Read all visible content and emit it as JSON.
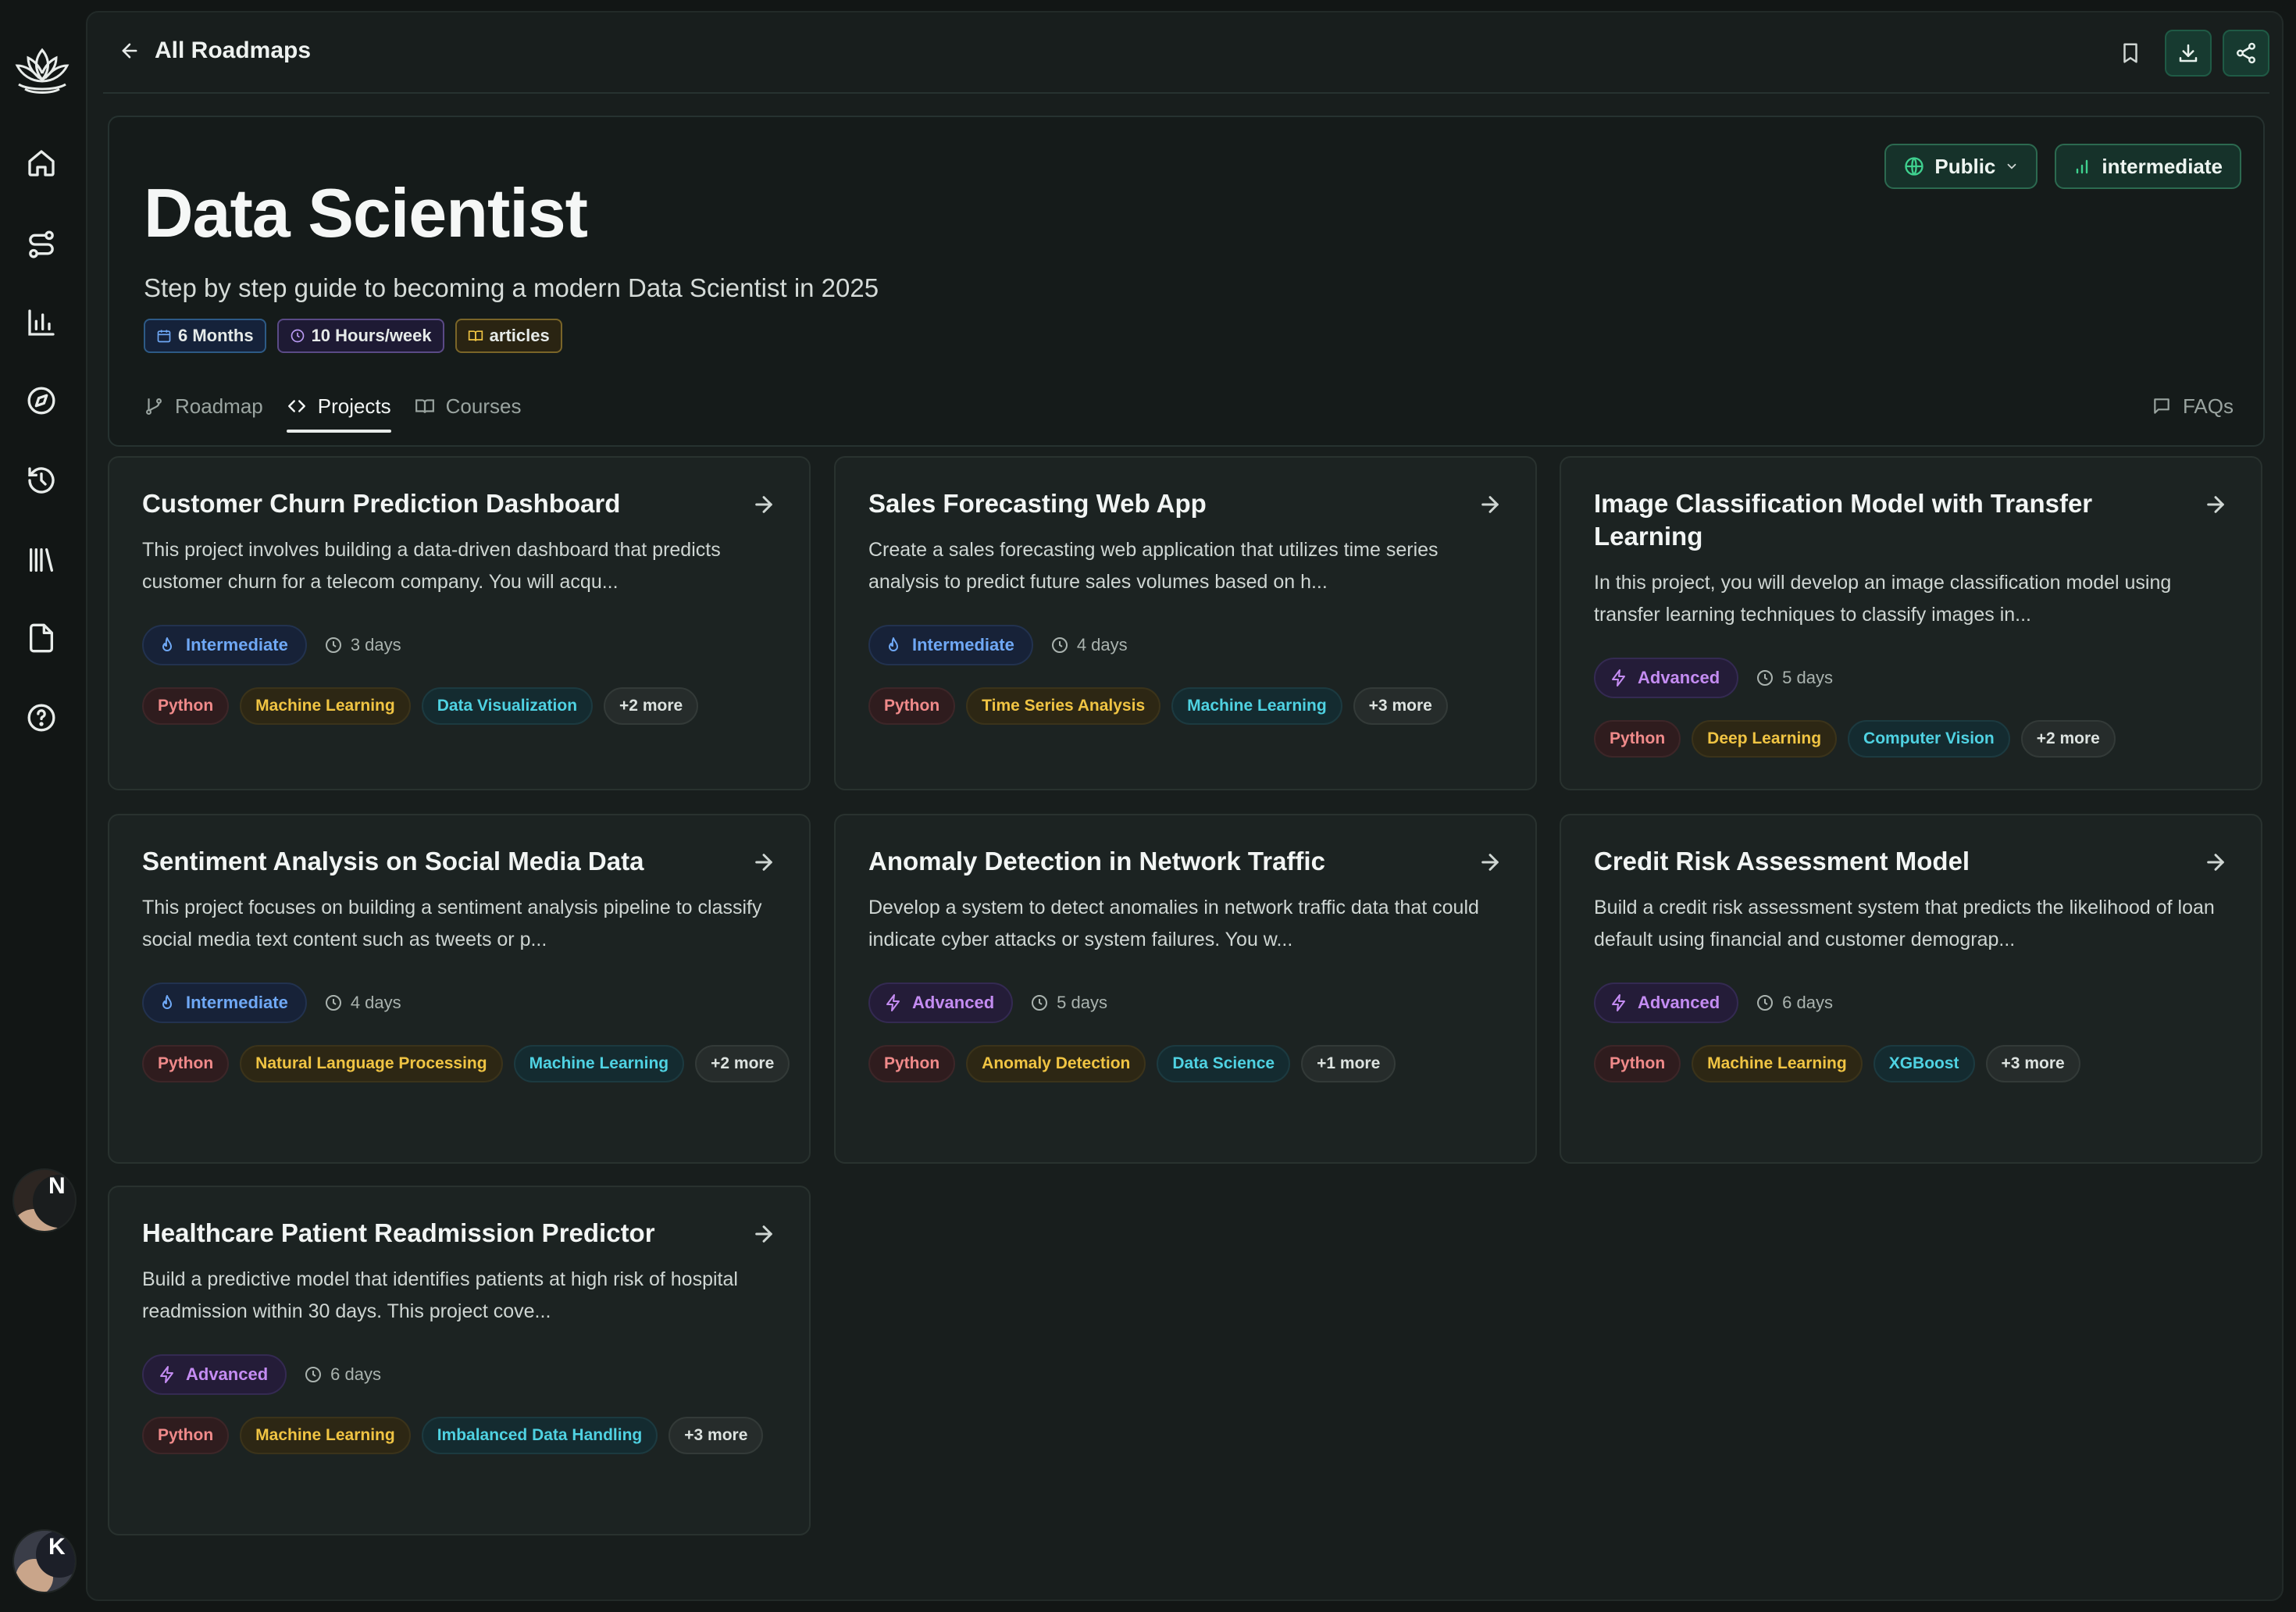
{
  "nav": {
    "back_label": "All Roadmaps"
  },
  "roadmap": {
    "title": "Data Scientist",
    "subtitle": "Step by step guide to becoming a modern Data Scientist in 2025",
    "badges": {
      "duration": "6 Months",
      "hours": "10 Hours/week",
      "format": "articles"
    },
    "visibility": "Public",
    "level": "intermediate"
  },
  "tabs": {
    "roadmap": "Roadmap",
    "projects": "Projects",
    "courses": "Courses",
    "faqs": "FAQs"
  },
  "avatar": {
    "initial_top": "N",
    "initial_bottom": "K"
  },
  "projects": [
    {
      "title": "Customer Churn Prediction Dashboard",
      "description": "This project involves building a data-driven dashboard that predicts customer churn for a telecom company. You will acqu...",
      "level": "Intermediate",
      "duration": "3 days",
      "tags": [
        "Python",
        "Machine Learning",
        "Data Visualization",
        "+2 more"
      ]
    },
    {
      "title": "Sales Forecasting Web App",
      "description": "Create a sales forecasting web application that utilizes time series analysis to predict future sales volumes based on h...",
      "level": "Intermediate",
      "duration": "4 days",
      "tags": [
        "Python",
        "Time Series Analysis",
        "Machine Learning",
        "+3 more"
      ]
    },
    {
      "title": "Image Classification Model with Transfer Learning",
      "description": "In this project, you will develop an image classification model using transfer learning techniques to classify images in...",
      "level": "Advanced",
      "duration": "5 days",
      "tags": [
        "Python",
        "Deep Learning",
        "Computer Vision",
        "+2 more"
      ]
    },
    {
      "title": "Sentiment Analysis on Social Media Data",
      "description": "This project focuses on building a sentiment analysis pipeline to classify social media text content such as tweets or p...",
      "level": "Intermediate",
      "duration": "4 days",
      "tags": [
        "Python",
        "Natural Language Processing",
        "Machine Learning",
        "+2 more"
      ]
    },
    {
      "title": "Anomaly Detection in Network Traffic",
      "description": "Develop a system to detect anomalies in network traffic data that could indicate cyber attacks or system failures. You w...",
      "level": "Advanced",
      "duration": "5 days",
      "tags": [
        "Python",
        "Anomaly Detection",
        "Data Science",
        "+1 more"
      ]
    },
    {
      "title": "Credit Risk Assessment Model",
      "description": "Build a credit risk assessment system that predicts the likelihood of loan default using financial and customer demograp...",
      "level": "Advanced",
      "duration": "6 days",
      "tags": [
        "Python",
        "Machine Learning",
        "XGBoost",
        "+3 more"
      ]
    },
    {
      "title": "Healthcare Patient Readmission Predictor",
      "description": "Build a predictive model that identifies patients at high risk of hospital readmission within 30 days. This project cove...",
      "level": "Advanced",
      "duration": "6 days",
      "tags": [
        "Python",
        "Machine Learning",
        "Imbalanced Data Handling",
        "+3 more"
      ]
    }
  ],
  "colors": {
    "background": "#121615",
    "panel": "#181e1d",
    "card": "#1c2322",
    "accent_green": "#2c6a50",
    "intermediate": "#6fa8f5",
    "advanced": "#c48cf2",
    "tag_python": "#f08a8a",
    "tag_yellow": "#f0c443",
    "tag_cyan": "#4fd2e2"
  }
}
